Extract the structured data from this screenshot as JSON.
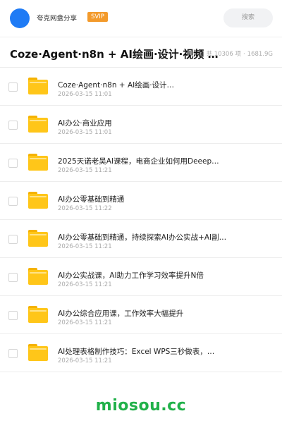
{
  "header": {
    "app_name": "夸克网盘分享",
    "badge": "SVIP",
    "search_placeholder": "搜索"
  },
  "folder": {
    "title": "Coze·Agent·n8n + AI绘画·设计·视频 + AI…",
    "count": "共 10306 项",
    "size": "1681.9G"
  },
  "items": [
    {
      "name": "Coze·Agent·n8n + AI绘画·设计…",
      "date": "2026-03-15 11:01"
    },
    {
      "name": "AI办公·商业应用",
      "date": "2026-03-15 11:01"
    },
    {
      "name": "2025天诺老吴AI课程，电商企业如何用Deeep…",
      "date": "2026-03-15 11:21"
    },
    {
      "name": "AI办公零基础到精通",
      "date": "2026-03-15 11:22"
    },
    {
      "name": "AI办公零基础到精通，持续探索AI办公实战+AI副…",
      "date": "2026-03-15 11:21"
    },
    {
      "name": "AI办公实战课，AI助力工作学习效率提升N倍",
      "date": "2026-03-15 11:21"
    },
    {
      "name": "AI办公综合应用课，工作效率大幅提升",
      "date": "2026-03-15 11:21"
    },
    {
      "name": "AI处理表格制作技巧：Excel WPS三秒做表，…",
      "date": "2026-03-15 11:21"
    }
  ],
  "watermark": "miosou.cc",
  "colors": {
    "avatar": "#1f7bf5",
    "badge": "#f39a2b",
    "folder": "#ffc619",
    "watermark": "#21b14a"
  }
}
